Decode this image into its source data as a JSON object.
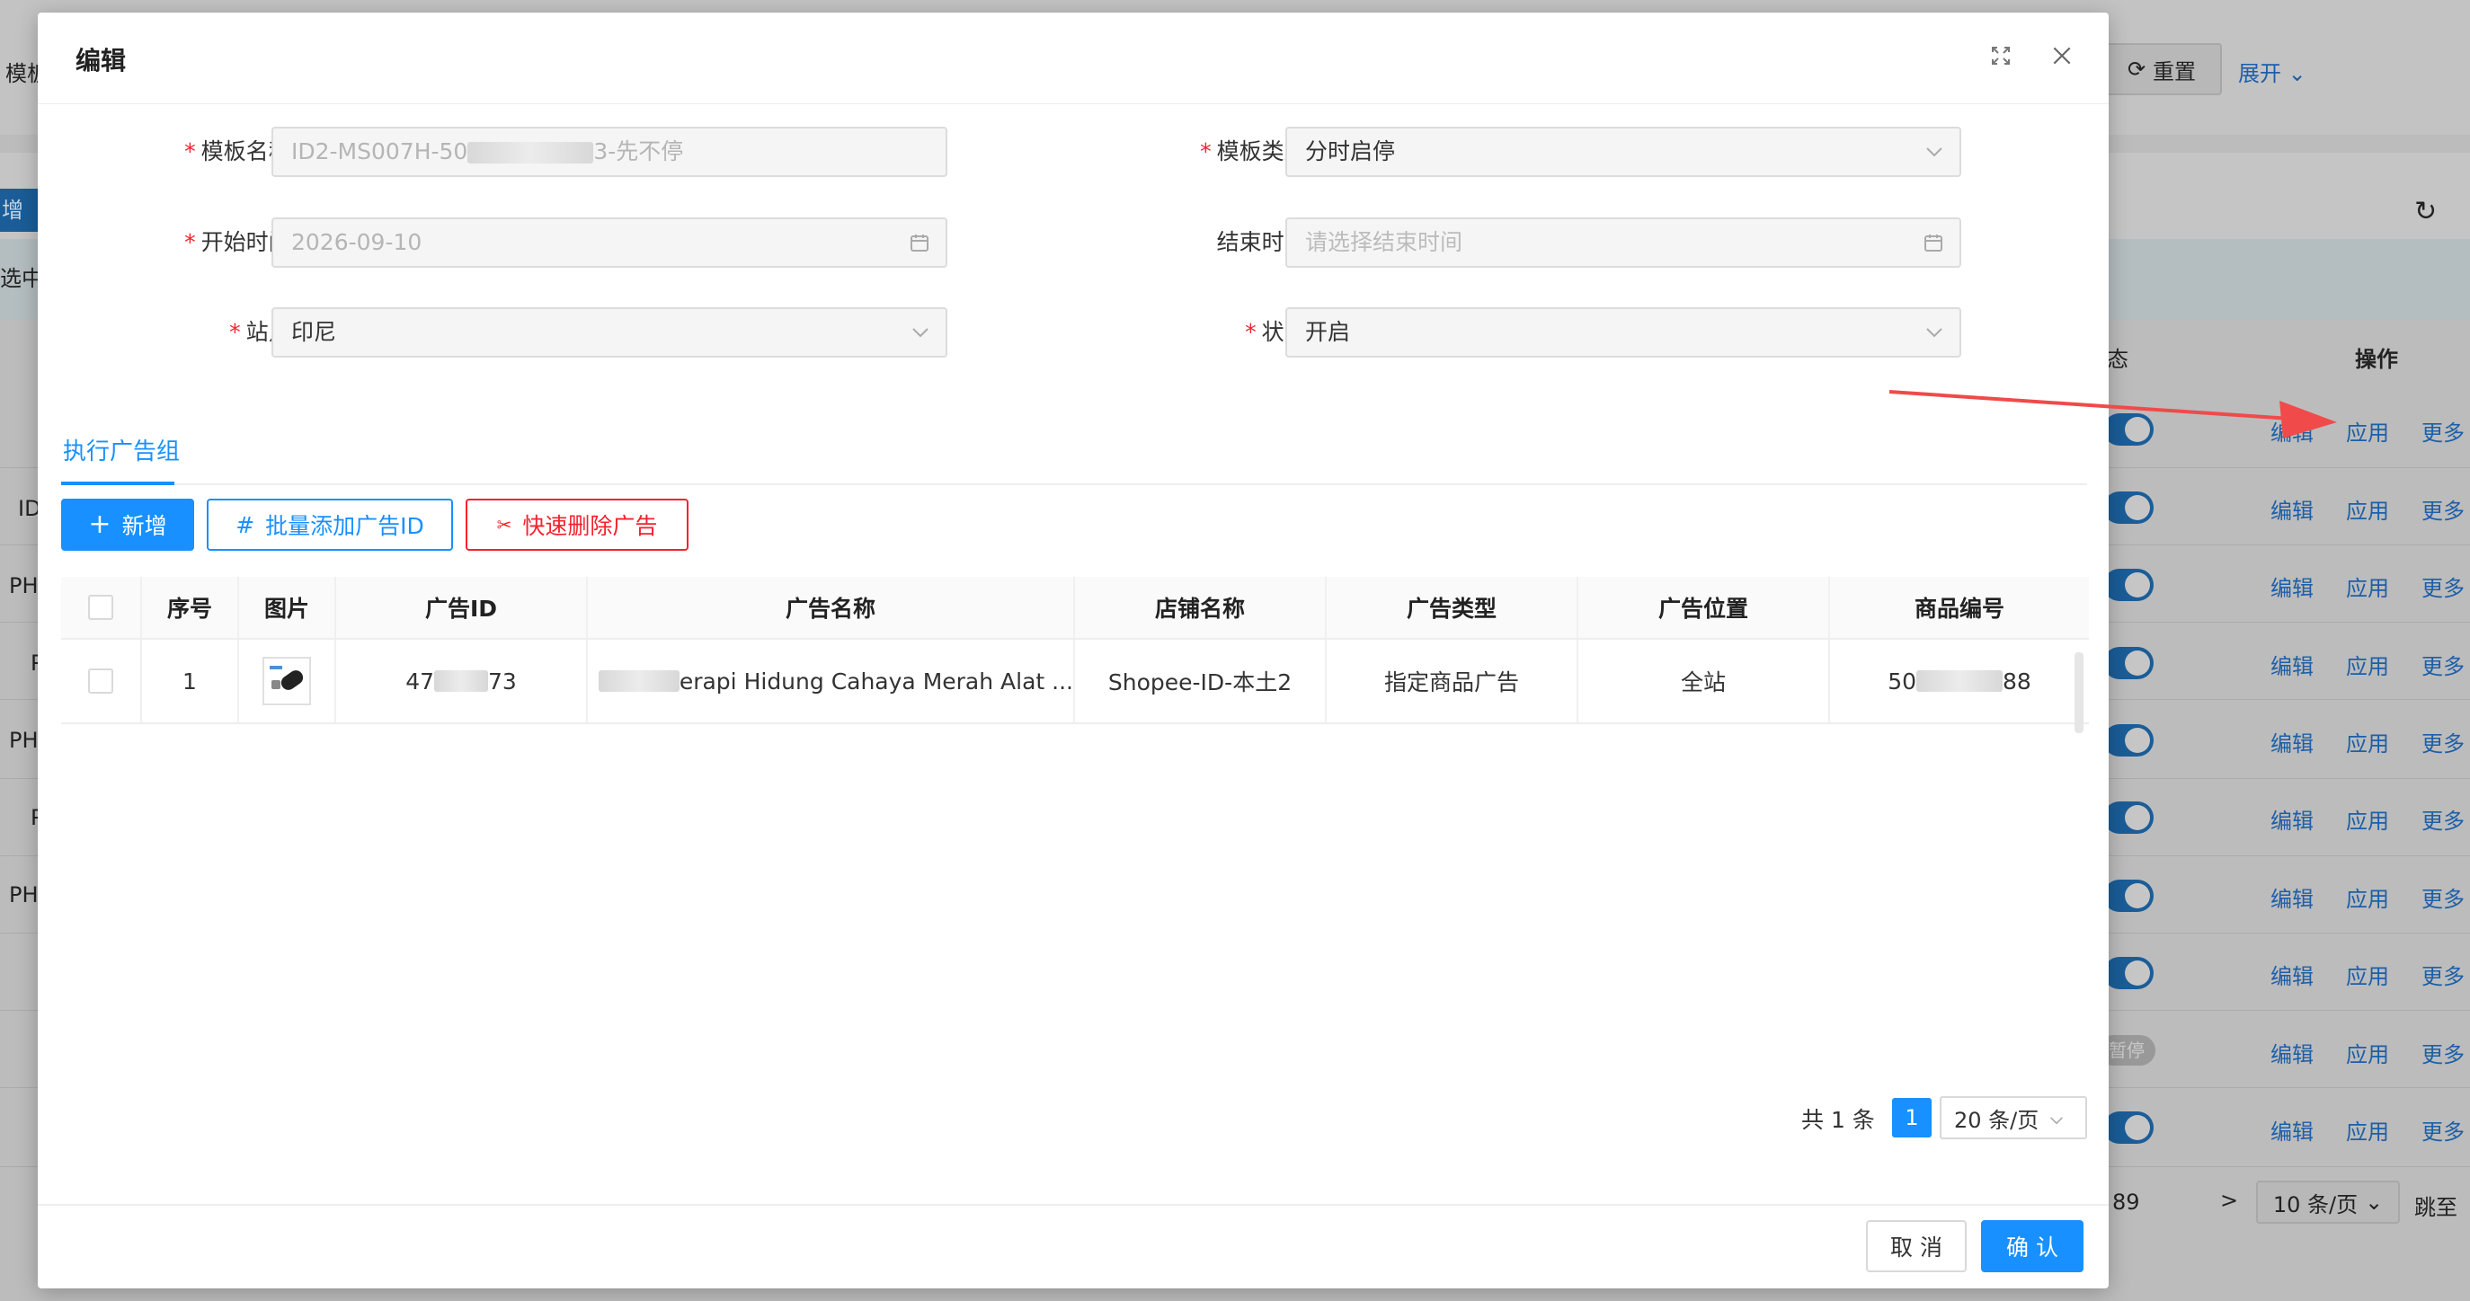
{
  "background": {
    "left_labels": [
      "模板",
      "增",
      "选中",
      "ID",
      "PH",
      "P",
      "PH",
      "P",
      "PH"
    ],
    "reset_label": "重置",
    "expand_label": "展开",
    "col_status": "态",
    "col_action": "操作",
    "row_actions": {
      "edit": "编辑",
      "apply": "应用",
      "more": "更多"
    },
    "paused_label": "暂停",
    "pagination": {
      "last_page": "89",
      "next": ">",
      "page_size": "10 条/页",
      "jump": "跳至"
    }
  },
  "modal": {
    "title": "编辑",
    "form": {
      "template_name_label": "模板名称:",
      "template_name_value_prefix": "ID2-MS007H-50",
      "template_name_value_suffix": "3-先不停",
      "template_type_label": "模板类型:",
      "template_type_value": "分时启停",
      "start_time_label": "开始时间:",
      "start_time_value": "2026-09-10",
      "end_time_label": "结束时间:",
      "end_time_placeholder": "请选择结束时间",
      "site_label": "站点:",
      "site_value": "印尼",
      "status_label": "状态:",
      "status_value": "开启"
    },
    "tab": "执行广告组",
    "buttons": {
      "add": "新增",
      "batch_add": "批量添加广告ID",
      "quick_delete": "快速删除广告"
    },
    "table": {
      "headers": [
        "序号",
        "图片",
        "广告ID",
        "广告名称",
        "店铺名称",
        "广告类型",
        "广告位置",
        "商品编号"
      ],
      "rows": [
        {
          "index": "1",
          "ad_id_prefix": "47",
          "ad_id_suffix": "73",
          "ad_name": "erapi Hidung Cahaya Merah Alat ...",
          "shop": "Shopee-ID-本土2",
          "ad_type": "指定商品广告",
          "ad_position": "全站",
          "product_prefix": "50",
          "product_suffix": "88"
        }
      ]
    },
    "pagination": {
      "total": "共 1 条",
      "current": "1",
      "page_size": "20 条/页"
    },
    "footer": {
      "cancel": "取 消",
      "confirm": "确 认"
    }
  },
  "colors": {
    "primary": "#1890ff",
    "danger": "#f5222d",
    "annotation_arrow": "#f04a4a"
  }
}
